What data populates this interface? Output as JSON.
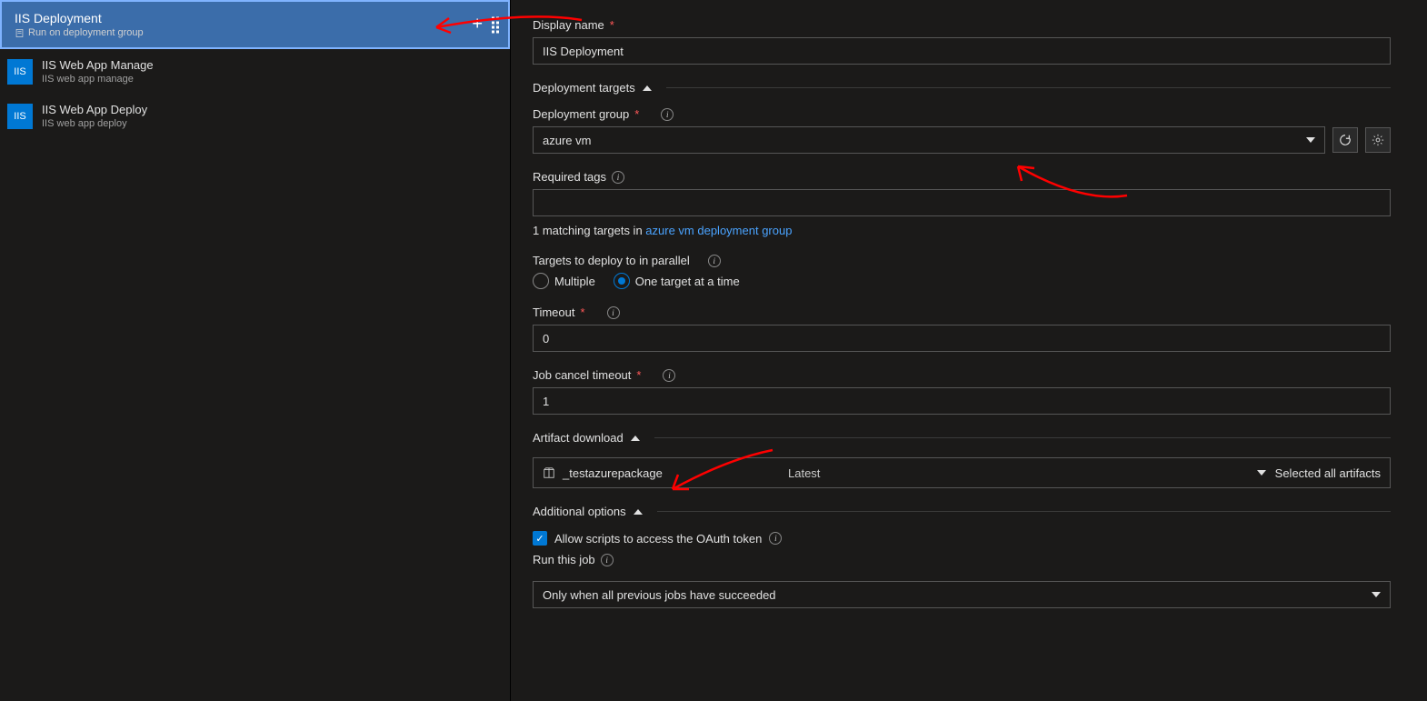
{
  "leftPanel": {
    "header": {
      "title": "IIS Deployment",
      "subtitle": "Run on deployment group"
    },
    "tasks": [
      {
        "badge": "IIS",
        "title": "IIS Web App Manage",
        "subtitle": "IIS web app manage"
      },
      {
        "badge": "IIS",
        "title": "IIS Web App Deploy",
        "subtitle": "IIS web app deploy"
      }
    ]
  },
  "form": {
    "displayName": {
      "label": "Display name",
      "value": "IIS Deployment"
    },
    "sections": {
      "deploymentTargets": "Deployment targets",
      "artifactDownload": "Artifact download",
      "additionalOptions": "Additional options"
    },
    "deploymentGroup": {
      "label": "Deployment group",
      "value": "azure vm"
    },
    "requiredTags": {
      "label": "Required tags",
      "value": ""
    },
    "matching": {
      "prefix": "1 matching targets in ",
      "link": "azure vm deployment group"
    },
    "parallel": {
      "label": "Targets to deploy to in parallel",
      "options": {
        "multiple": "Multiple",
        "one": "One target at a time"
      }
    },
    "timeout": {
      "label": "Timeout",
      "value": "0"
    },
    "jobCancelTimeout": {
      "label": "Job cancel timeout",
      "value": "1"
    },
    "artifact": {
      "name": "_testazurepackage",
      "version": "Latest",
      "status": "Selected all artifacts"
    },
    "oauth": {
      "label": "Allow scripts to access the OAuth token"
    },
    "runThisJob": {
      "label": "Run this job",
      "value": "Only when all previous jobs have succeeded"
    }
  }
}
